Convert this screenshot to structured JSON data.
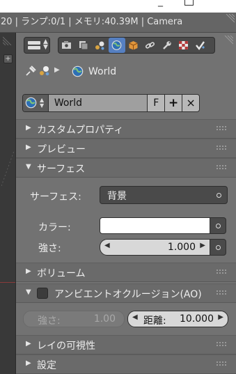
{
  "window": {
    "info_text": "20 | ランプ:0/1 | メモリ:40.39M | Camera"
  },
  "header": {
    "context_tabs": [
      "render-tab",
      "render-layers-tab",
      "scene-tab",
      "world-tab",
      "object-tab",
      "constraints-tab",
      "modifiers-tab",
      "texture-tab",
      "particles-tab"
    ],
    "active_tab": "world-tab"
  },
  "breadcrumb": {
    "world_label": "World"
  },
  "world_field": {
    "name": "World",
    "fake_user_label": "F",
    "add_label": "+",
    "close_label": "×"
  },
  "sections": {
    "custom_props": "カスタムプロパティ",
    "preview": "プレビュー",
    "surface": "サーフェス",
    "volume": "ボリューム",
    "ao": "アンビエントオクルージョン(AO)",
    "ray_visibility": "レイの可視性",
    "settings": "設定"
  },
  "surface": {
    "surface_label": "サーフェス:",
    "surface_value": "背景",
    "color_label": "カラー:",
    "color_value": "#ffffff",
    "strength_label": "強さ:",
    "strength_value": "1.000"
  },
  "ao": {
    "strength_label": "強さ:",
    "strength_value": "1.00",
    "distance_label": "距離:",
    "distance_value": "10.000"
  }
}
